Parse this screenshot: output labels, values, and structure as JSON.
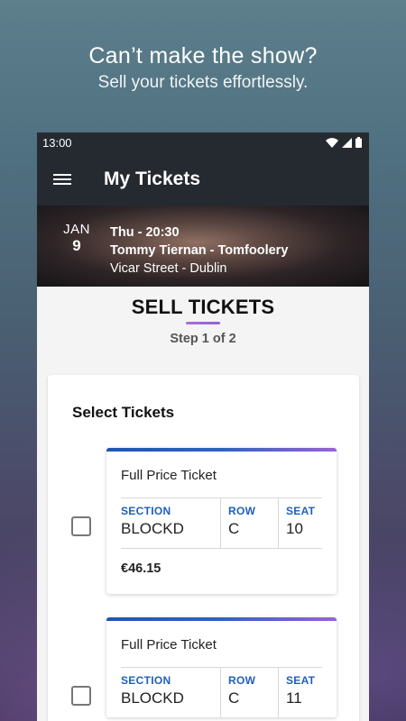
{
  "promo": {
    "headline": "Can’t make the show?",
    "subline": "Sell your tickets effortlessly."
  },
  "status_bar": {
    "time": "13:00"
  },
  "app_bar": {
    "title": "My Tickets"
  },
  "event": {
    "month": "JAN",
    "day": "9",
    "time": "Thu - 20:30",
    "name": "Tommy Tiernan - Tomfoolery",
    "venue": "Vicar Street - Dublin"
  },
  "sell": {
    "title": "SELL TICKETS",
    "step": "Step 1 of 2",
    "select_title": "Select Tickets"
  },
  "tickets": [
    {
      "name": "Full Price Ticket",
      "section_label": "SECTION",
      "section": "BLOCKD",
      "row_label": "ROW",
      "row": "C",
      "seat_label": "SEAT",
      "seat": "10",
      "price": "€46.15"
    },
    {
      "name": "Full Price Ticket",
      "section_label": "SECTION",
      "section": "BLOCKD",
      "row_label": "ROW",
      "row": "C",
      "seat_label": "SEAT",
      "seat": "11",
      "price": ""
    }
  ],
  "colors": {
    "app_bar": "#252a31",
    "accent_blue": "#1f5fbd",
    "accent_purple": "#9a62d8"
  }
}
